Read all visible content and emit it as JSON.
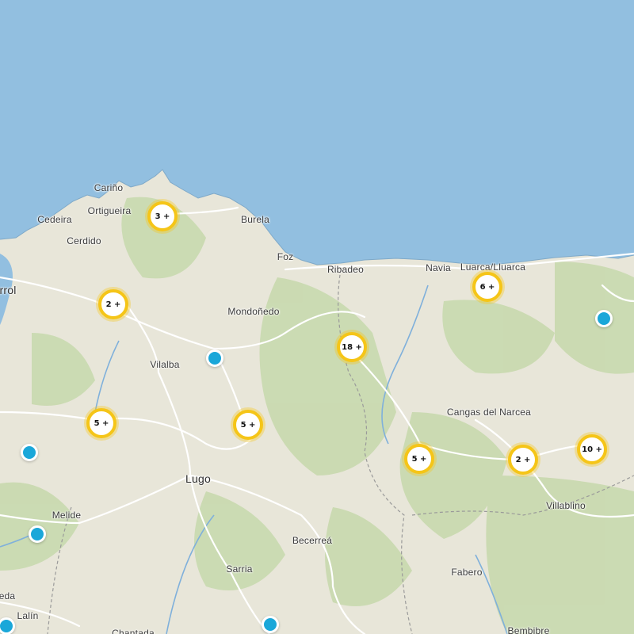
{
  "colors": {
    "sea": "#92bfe0",
    "land": "#e8e6d9",
    "forest": "#c8d9ae",
    "road": "#ffffff",
    "river": "#7fb0db",
    "border": "#9a9a9a",
    "cluster_ring": "#f5c518",
    "marker": "#1aa7d9"
  },
  "places": [
    {
      "id": "carino",
      "label": "Cariño"
    },
    {
      "id": "ortigueira",
      "label": "Ortigueira"
    },
    {
      "id": "cedeira",
      "label": "Cedeira"
    },
    {
      "id": "cerdido",
      "label": "Cerdido"
    },
    {
      "id": "burela",
      "label": "Burela"
    },
    {
      "id": "foz",
      "label": "Foz"
    },
    {
      "id": "ribadeo",
      "label": "Ribadeo"
    },
    {
      "id": "navia",
      "label": "Navia"
    },
    {
      "id": "luarca",
      "label": "Luarca/Lluarca"
    },
    {
      "id": "ferrol",
      "label": "rrol"
    },
    {
      "id": "mondonedo",
      "label": "Mondoñedo"
    },
    {
      "id": "vilalba",
      "label": "Vilalba"
    },
    {
      "id": "cangas",
      "label": "Cangas del Narcea"
    },
    {
      "id": "lugo",
      "label": "Lugo"
    },
    {
      "id": "villablino",
      "label": "Villablino"
    },
    {
      "id": "melide",
      "label": "Melide"
    },
    {
      "id": "becerrea",
      "label": "Becerreá"
    },
    {
      "id": "sarria",
      "label": "Sarria"
    },
    {
      "id": "fabero",
      "label": "Fabero"
    },
    {
      "id": "lalin",
      "label": "Lalín"
    },
    {
      "id": "eda",
      "label": "eda"
    },
    {
      "id": "chantada",
      "label": "Chantada"
    },
    {
      "id": "bembibre",
      "label": "Bembibre"
    }
  ],
  "clusters": [
    {
      "id": "c1",
      "label": "3 +"
    },
    {
      "id": "c2",
      "label": "2 +"
    },
    {
      "id": "c3",
      "label": "6 +"
    },
    {
      "id": "c4",
      "label": "18 +"
    },
    {
      "id": "c5",
      "label": "5 +"
    },
    {
      "id": "c6",
      "label": "5 +"
    },
    {
      "id": "c7",
      "label": "5 +"
    },
    {
      "id": "c8",
      "label": "2 +"
    },
    {
      "id": "c9",
      "label": "10 +"
    }
  ],
  "markers": [
    "m1",
    "m2",
    "m3",
    "m4",
    "m5",
    "m6",
    "m7"
  ]
}
